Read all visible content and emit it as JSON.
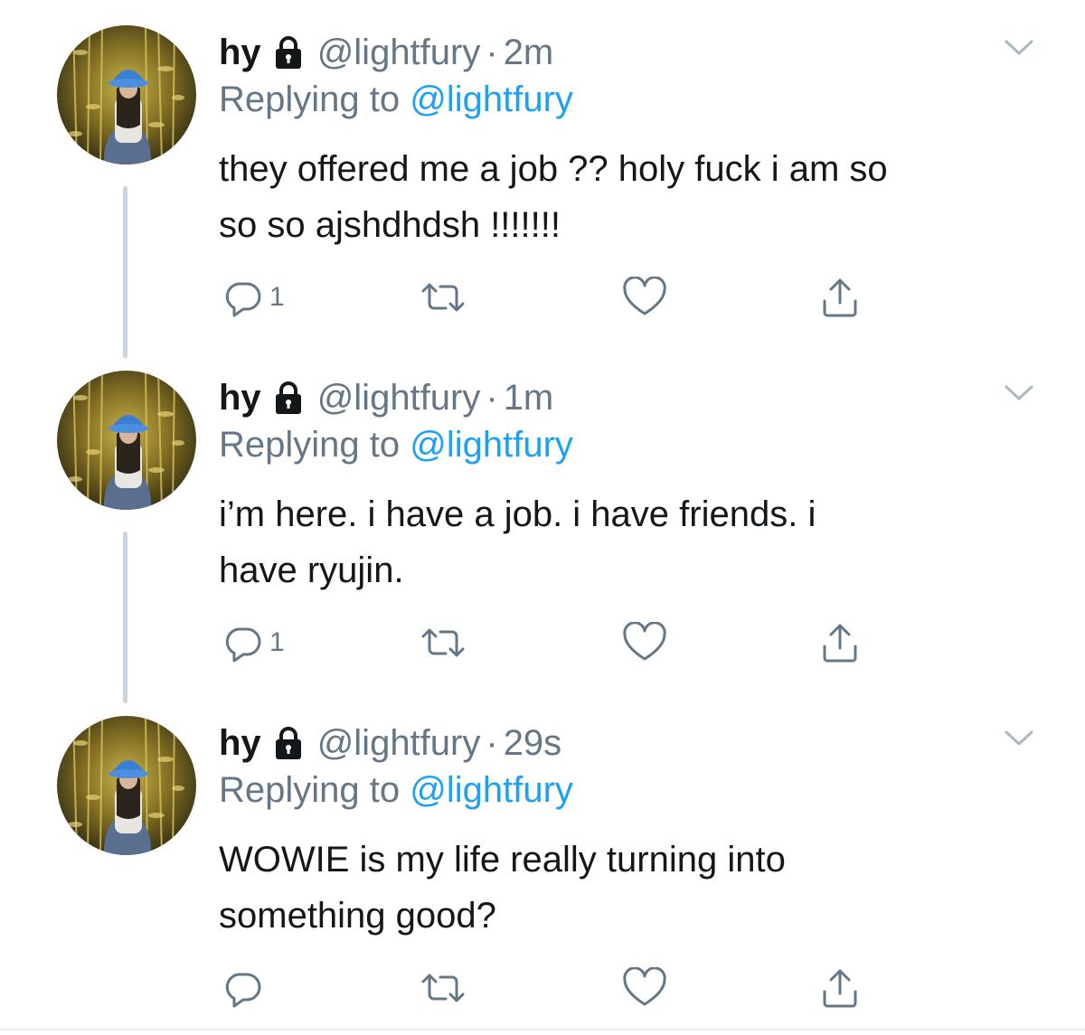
{
  "colors": {
    "text": "#14171a",
    "secondary": "#657786",
    "link": "#1da1f2",
    "thread_line": "#cdd6dd"
  },
  "tweets": [
    {
      "name": "hy",
      "handle": "@lightfury",
      "separator": "·",
      "time": "2m",
      "replying_prefix": "Replying to",
      "replying_to": "@lightfury",
      "text_lines": [
        "they offered me a job ?? holy fuck i am so",
        "so so ajshdhdsh !!!!!!!"
      ],
      "reply_count": "1",
      "icons": {
        "lock": "lock-icon",
        "menu": "chevron-down-icon",
        "reply": "reply-icon",
        "retweet": "retweet-icon",
        "like": "heart-icon",
        "share": "share-icon"
      }
    },
    {
      "name": "hy",
      "handle": "@lightfury",
      "separator": "·",
      "time": "1m",
      "replying_prefix": "Replying to",
      "replying_to": "@lightfury",
      "text_lines": [
        "i’m here. i have a job. i have friends. i",
        "have ryujin."
      ],
      "reply_count": "1",
      "icons": {
        "lock": "lock-icon",
        "menu": "chevron-down-icon",
        "reply": "reply-icon",
        "retweet": "retweet-icon",
        "like": "heart-icon",
        "share": "share-icon"
      }
    },
    {
      "name": "hy",
      "handle": "@lightfury",
      "separator": "·",
      "time": "29s",
      "replying_prefix": "Replying to",
      "replying_to": "@lightfury",
      "text_lines": [
        "WOWIE is my life really turning into",
        "something good?"
      ],
      "reply_count": "",
      "icons": {
        "lock": "lock-icon",
        "menu": "chevron-down-icon",
        "reply": "reply-icon",
        "retweet": "retweet-icon",
        "like": "heart-icon",
        "share": "share-icon"
      }
    }
  ]
}
